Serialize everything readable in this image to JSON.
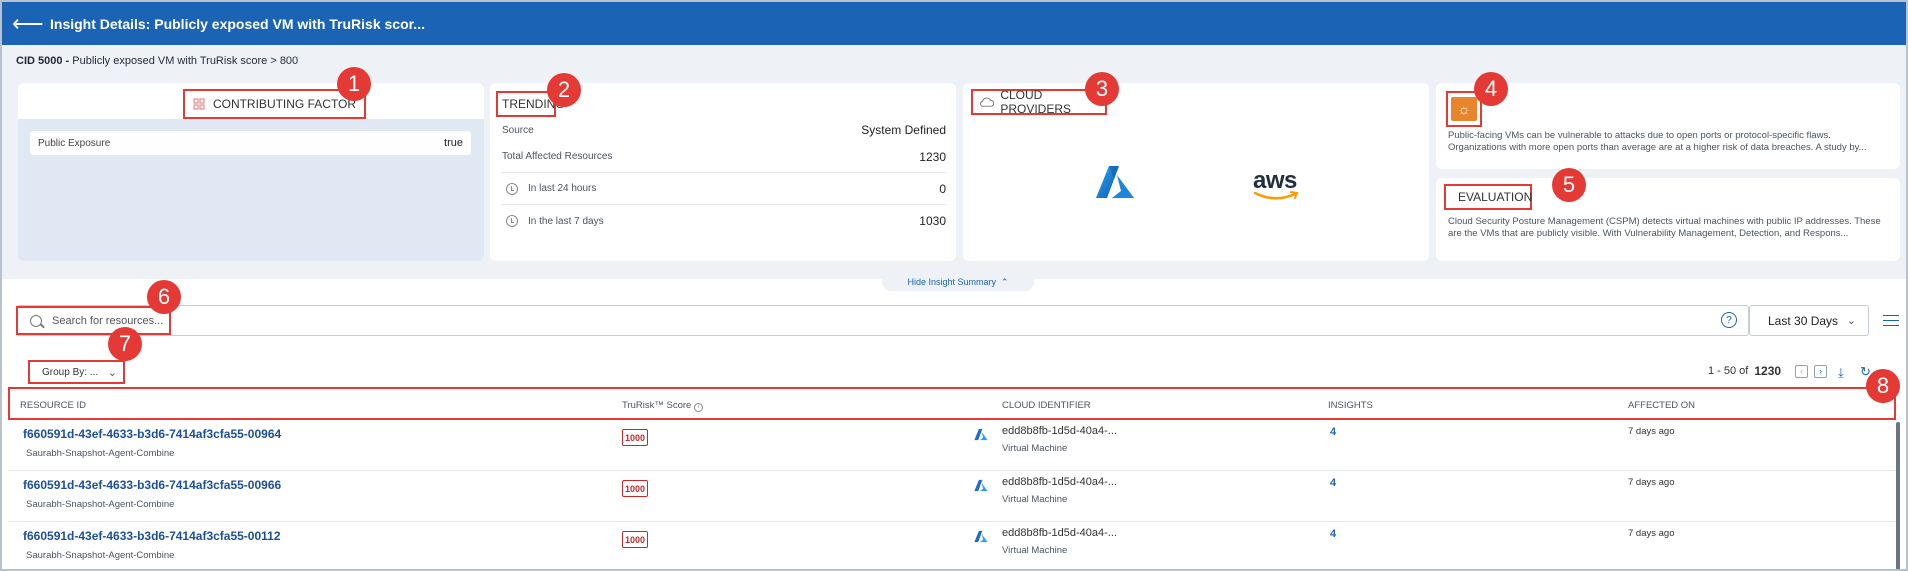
{
  "header": {
    "back_icon": "back-arrow-icon",
    "title": "Insight Details: Publicly exposed VM with TruRisk scor..."
  },
  "cid": {
    "label": "CID 5000 -",
    "text": "Publicly exposed VM with TruRisk score > 800"
  },
  "contributing": {
    "title": "CONTRIBUTING FACTOR",
    "row_label": "Public Exposure",
    "row_value": "true"
  },
  "trending": {
    "title": "TRENDING",
    "rows": [
      {
        "label": "Source",
        "value": "System Defined"
      },
      {
        "label": "Total Affected Resources",
        "value": "1230"
      },
      {
        "label": "In last 24 hours",
        "value": "0"
      },
      {
        "label": "In the last 7 days",
        "value": "1030"
      }
    ]
  },
  "cloud": {
    "title": "CLOUD PROVIDERS",
    "aws_text": "aws"
  },
  "description": {
    "text": "Public-facing VMs can be vulnerable to attacks due to open ports or protocol-specific flaws. Organizations with more open ports than average are at a higher risk of data breaches. A study by..."
  },
  "evaluation": {
    "title": "EVALUATION",
    "text": "Cloud Security Posture Management (CSPM) detects virtual machines with public IP addresses. These are the VMs that are publicly visible. With Vulnerability Management, Detection, and Respons..."
  },
  "summary_toggle": "Hide Insight Summary",
  "search": {
    "placeholder": "Search for resources..."
  },
  "date_filter": "Last 30 Days",
  "group_by": "Group By: ...",
  "pager": {
    "range": "1 - 50 of",
    "total": "1230"
  },
  "table": {
    "headers": [
      "RESOURCE ID",
      "TruRisk™ Score",
      "CLOUD IDENTIFIER",
      "INSIGHTS",
      "AFFECTED ON"
    ],
    "rows": [
      {
        "id": "f660591d-43ef-4633-b3d6-7414af3cfa55-00964",
        "sub": "Saurabh-Snapshot-Agent-Combine",
        "score": "1000",
        "cloud_id": "edd8b8fb-1d5d-40a4-...",
        "cloud_type": "Virtual Machine",
        "insights": "4",
        "affected": "7 days ago"
      },
      {
        "id": "f660591d-43ef-4633-b3d6-7414af3cfa55-00966",
        "sub": "Saurabh-Snapshot-Agent-Combine",
        "score": "1000",
        "cloud_id": "edd8b8fb-1d5d-40a4-...",
        "cloud_type": "Virtual Machine",
        "insights": "4",
        "affected": "7 days ago"
      },
      {
        "id": "f660591d-43ef-4633-b3d6-7414af3cfa55-00112",
        "sub": "Saurabh-Snapshot-Agent-Combine",
        "score": "1000",
        "cloud_id": "edd8b8fb-1d5d-40a4-...",
        "cloud_type": "Virtual Machine",
        "insights": "4",
        "affected": "7 days ago"
      }
    ]
  },
  "badges": [
    "1",
    "2",
    "3",
    "4",
    "5",
    "6",
    "7",
    "8"
  ],
  "colors": {
    "header_blue": "#1b64b5",
    "highlight_red": "#e53935",
    "score_red": "#c62828",
    "bulb_orange": "#e8842c"
  }
}
